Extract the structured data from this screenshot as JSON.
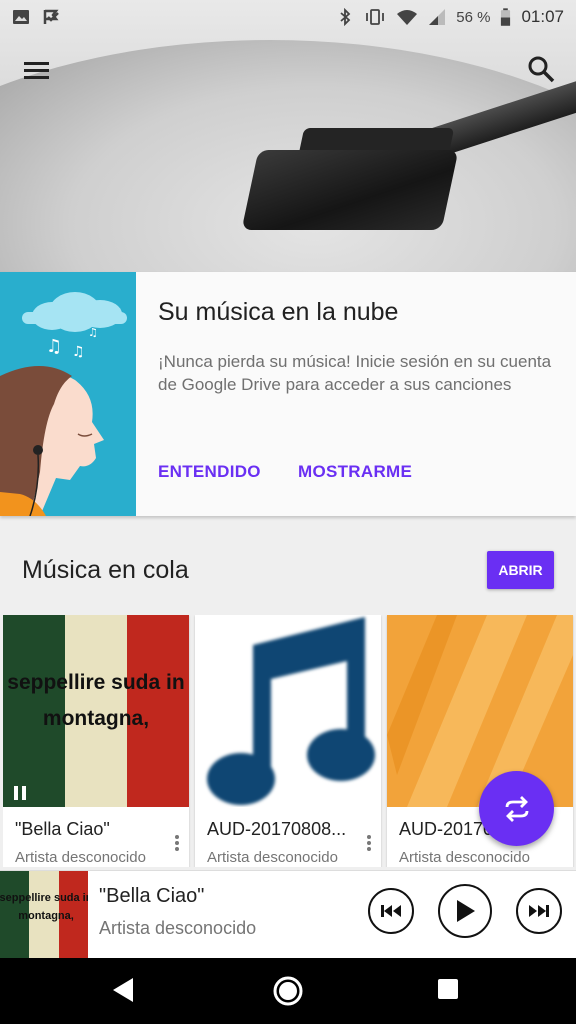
{
  "status_bar": {
    "battery_percent": "56 %",
    "time": "01:07"
  },
  "promo": {
    "title": "Su música en la nube",
    "body": "¡Nunca pierda su música! Inicie sesión en su cuenta de Google Drive para acceder a sus canciones",
    "button_ok": "ENTENDIDO",
    "button_show": "MOSTRARME"
  },
  "queue": {
    "title": "Música en cola",
    "open_button": "ABRIR",
    "cards": [
      {
        "title": "\"Bella Ciao\"",
        "artist": "Artista desconocido",
        "art_text_1": "seppellire suda in",
        "art_text_2": "montagna,"
      },
      {
        "title": "AUD-20170808...",
        "artist": "Artista desconocido"
      },
      {
        "title": "AUD-20170...",
        "artist": "Artista desconocido"
      }
    ]
  },
  "player": {
    "title": "\"Bella Ciao\"",
    "artist": "Artista desconocido",
    "art_text_1": "seppellire suda in",
    "art_text_2": "montagna,"
  },
  "colors": {
    "accent": "#6a2ff3",
    "promo_art_bg": "#29aecd"
  },
  "icons": [
    "image-icon",
    "check-flag-icon",
    "bluetooth-icon",
    "vibrate-icon",
    "wifi-icon",
    "signal-icon",
    "battery-icon",
    "menu-icon",
    "search-icon",
    "pause-icon",
    "more-vert-icon",
    "shuffle-repeat-icon",
    "skip-previous-icon",
    "play-icon",
    "skip-next-icon",
    "back-icon",
    "home-icon",
    "recents-icon"
  ]
}
